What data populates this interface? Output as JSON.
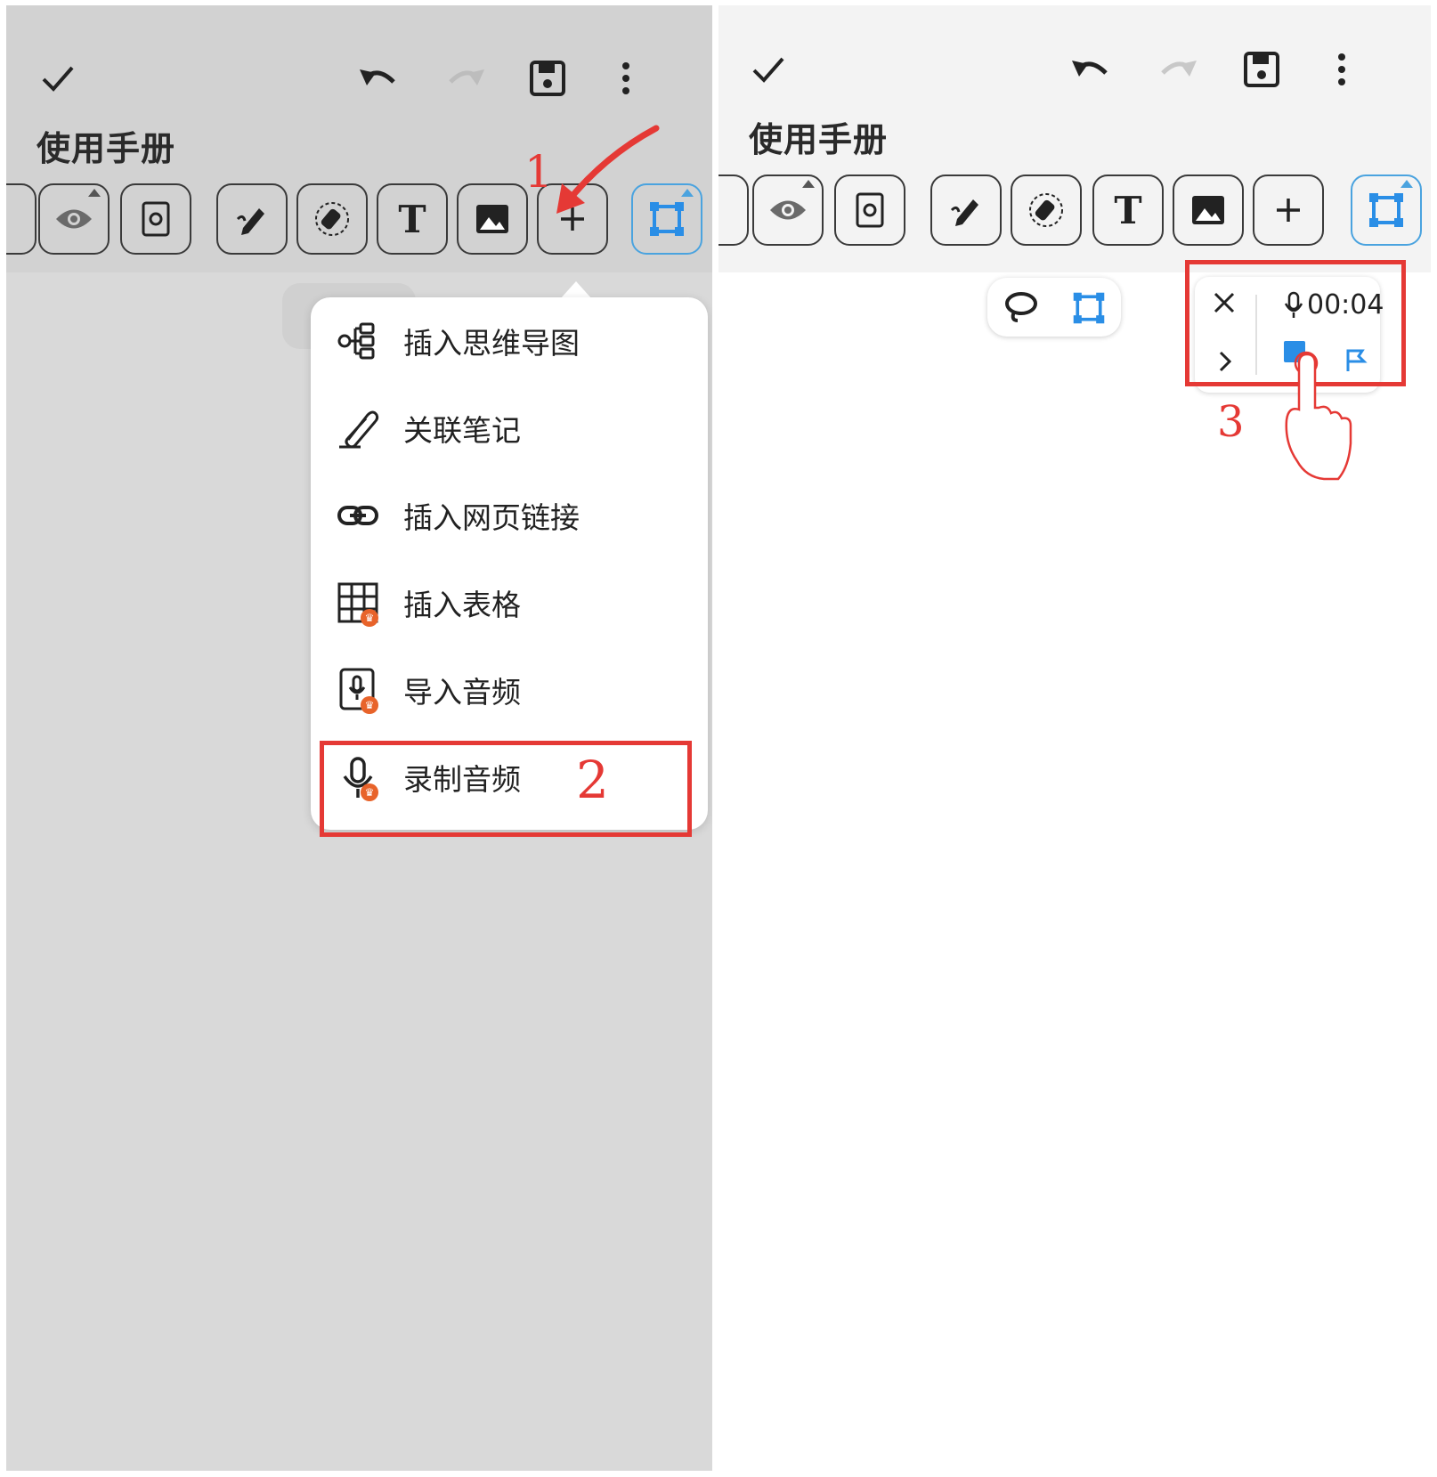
{
  "left_panel": {
    "header": {
      "confirm_icon": "check-icon",
      "undo_icon": "undo-icon",
      "redo_icon": "redo-icon",
      "save_icon": "save-icon",
      "more_icon": "more-vertical-icon"
    },
    "title": "使用手册",
    "toolbar": {
      "tools": [
        "read-mode-eye-icon",
        "page-settings-icon",
        "pen-icon",
        "eraser-icon",
        "text-icon",
        "image-icon",
        "add-icon",
        "selection-box-icon"
      ],
      "text_tool_label": "T"
    },
    "insert_menu": {
      "items": [
        {
          "label": "插入思维导图",
          "icon": "mindmap-icon",
          "premium": false
        },
        {
          "label": "关联笔记",
          "icon": "paperclip-icon",
          "premium": false
        },
        {
          "label": "插入网页链接",
          "icon": "link-icon",
          "premium": false
        },
        {
          "label": "插入表格",
          "icon": "table-icon",
          "premium": true
        },
        {
          "label": "导入音频",
          "icon": "audio-file-icon",
          "premium": true
        },
        {
          "label": "录制音频",
          "icon": "microphone-icon",
          "premium": true
        }
      ]
    },
    "annotations": {
      "step1": "1",
      "step2": "2"
    }
  },
  "right_panel": {
    "title": "使用手册",
    "floating_tools": [
      "lasso-icon",
      "selection-box-icon"
    ],
    "recorder": {
      "close_icon": "close-icon",
      "expand_icon": "chevron-right-icon",
      "mic_icon": "microphone-icon",
      "timer": "00:04",
      "stop_icon": "stop-icon",
      "flag_icon": "flag-icon"
    },
    "annotations": {
      "step3": "3"
    }
  },
  "colors": {
    "accent_blue": "#2a8ee6",
    "annotation_red": "#e53935",
    "premium_badge": "#e8632a"
  }
}
